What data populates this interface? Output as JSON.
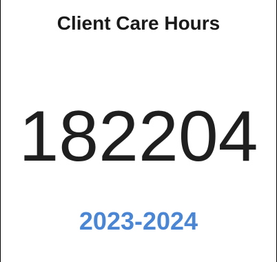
{
  "card": {
    "title": "Client Care Hours",
    "value": "182204",
    "period": "2023-2024",
    "period_color": "#4A86D4"
  }
}
